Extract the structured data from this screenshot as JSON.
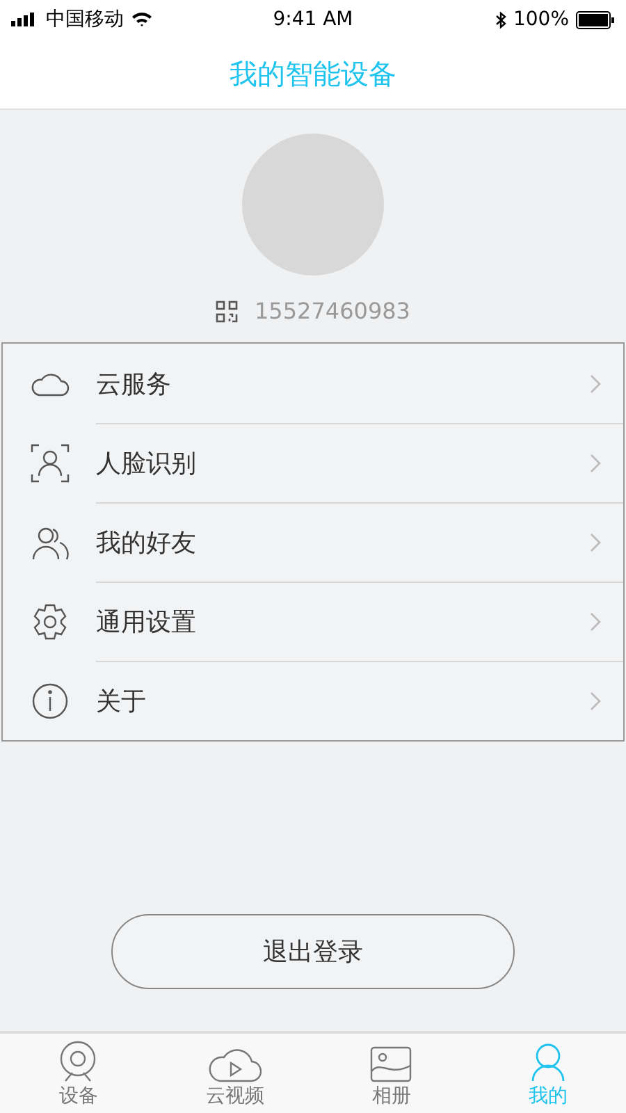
{
  "status_bar": {
    "carrier": "中国移动",
    "time": "9:41 AM",
    "battery": "100%"
  },
  "nav": {
    "title": "我的智能设备"
  },
  "profile": {
    "phone": "15527460983"
  },
  "menu": [
    {
      "kind": "cloud",
      "label": "云服务"
    },
    {
      "kind": "face",
      "label": "人脸识别"
    },
    {
      "kind": "friends",
      "label": "我的好友"
    },
    {
      "kind": "settings",
      "label": "通用设置"
    },
    {
      "kind": "info",
      "label": "关于"
    }
  ],
  "logout_button": "退出登录",
  "tabs": [
    {
      "kind": "device",
      "label": "设备",
      "selected": false
    },
    {
      "kind": "video",
      "label": "云视频",
      "selected": false
    },
    {
      "kind": "album",
      "label": "相册",
      "selected": false
    },
    {
      "kind": "me",
      "label": "我的",
      "selected": true
    }
  ]
}
